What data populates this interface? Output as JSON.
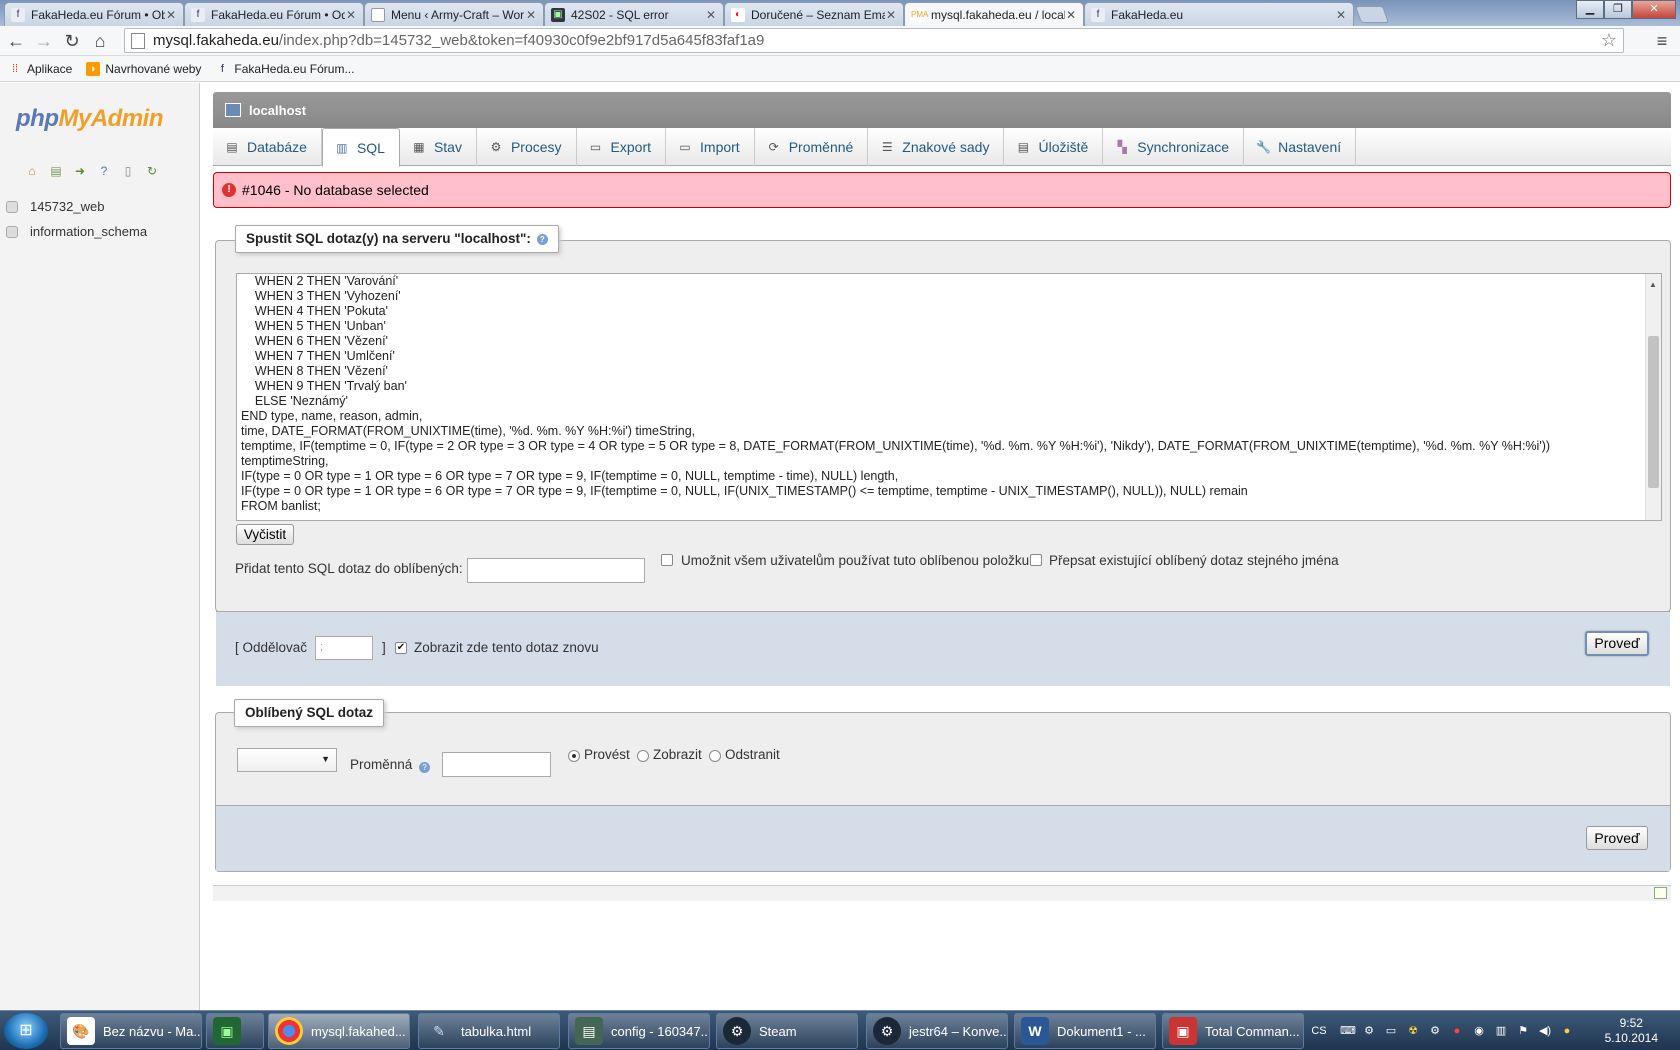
{
  "browser": {
    "tabs": [
      {
        "title": "FakaHeda.eu Fórum • Obs",
        "icon": "page-icon"
      },
      {
        "title": "FakaHeda.eu Fórum • Ode",
        "icon": "page-icon"
      },
      {
        "title": "Menu ‹ Army-Craft – Wor",
        "icon": "page-icon"
      },
      {
        "title": "42S02 - SQL error",
        "icon": "page-icon"
      },
      {
        "title": "Doručené – Seznam Email",
        "icon": "seznam-icon"
      },
      {
        "title": "mysql.fakaheda.eu / locall",
        "icon": "pma-icon"
      },
      {
        "title": "FakaHeda.eu",
        "icon": "page-icon"
      }
    ],
    "url_host": "mysql.fakaheda.eu",
    "url_path": "/index.php?db=145732_web&token=f40930c0f9e2bf917d5a645f83faf1a9",
    "bookmarks": [
      "Aplikace",
      "Navrhované weby",
      "FakaHeda.eu Fórum..."
    ]
  },
  "sidebar": {
    "logo_php": "php",
    "logo_myadmin": "MyAdmin",
    "databases": [
      "145732_web",
      "information_schema"
    ]
  },
  "server": {
    "name": "localhost"
  },
  "nav_tabs": [
    "Databáze",
    "SQL",
    "Stav",
    "Procesy",
    "Export",
    "Import",
    "Proměnné",
    "Znakové sady",
    "Úložiště",
    "Synchronizace",
    "Nastavení"
  ],
  "error": "#1046 - No database selected",
  "sql_section": {
    "legend": "Spustit SQL dotaz(y) na serveru \"localhost\":",
    "query_lines": [
      "    WHEN 2 THEN 'Varování'",
      "    WHEN 3 THEN 'Vyhození'",
      "    WHEN 4 THEN 'Pokuta'",
      "    WHEN 5 THEN 'Unban'",
      "    WHEN 6 THEN 'Vězení'",
      "    WHEN 7 THEN 'Umlčení'",
      "    WHEN 8 THEN 'Vězení'",
      "    WHEN 9 THEN 'Trvalý ban'",
      "    ELSE 'Neznámý'",
      "END type, name, reason, admin,",
      "time, DATE_FORMAT(FROM_UNIXTIME(time), '%d. %m. %Y %H:%i') timeString,",
      "temptime, IF(temptime = 0, IF(type = 2 OR type = 3 OR type = 4 OR type = 5 OR type = 8, DATE_FORMAT(FROM_UNIXTIME(time), '%d. %m. %Y %H:%i'), 'Nikdy'), DATE_FORMAT(FROM_UNIXTIME(temptime), '%d. %m. %Y %H:%i'))",
      "temptimeString,",
      "IF(type = 0 OR type = 1 OR type = 6 OR type = 7 OR type = 9, IF(temptime = 0, NULL, temptime - time), NULL) length,",
      "IF(type = 0 OR type = 1 OR type = 6 OR type = 7 OR type = 9, IF(temptime = 0, NULL, IF(UNIX_TIMESTAMP() <= temptime, temptime - UNIX_TIMESTAMP(), NULL)), NULL) remain",
      "FROM banlist;"
    ],
    "clear_button": "Vyčistit",
    "bookmark_label": "Přidat tento SQL dotaz do oblíbených:",
    "bookmark_value": "",
    "allow_all_label": "Umožnit všem uživatelům používat tuto oblíbenou položku",
    "replace_label": "Přepsat existující oblíbený dotaz stejného jména",
    "delimiter_label_open": "[ Oddělovač",
    "delimiter_value": ";",
    "delimiter_label_close": "]",
    "show_again_label": "Zobrazit zde tento dotaz znovu",
    "show_again_checked": true,
    "go_button": "Proveď"
  },
  "bookmark_section": {
    "legend": "Oblíbený SQL dotaz",
    "variable_label": "Proměnná",
    "variable_value": "",
    "radio_options": [
      "Provést",
      "Zobrazit",
      "Odstranit"
    ],
    "radio_selected": "Provést",
    "go_button": "Proveď"
  },
  "taskbar": {
    "items": [
      {
        "label": "Bez názvu - Ma...",
        "icon": "paint-icon"
      },
      {
        "label": "",
        "icon": "monitor-icon"
      },
      {
        "label": "mysql.fakahed...",
        "icon": "chrome-icon"
      },
      {
        "label": "tabulka.html",
        "icon": "pen-icon"
      },
      {
        "label": "config - 160347...",
        "icon": "folder-icon"
      },
      {
        "label": "Steam",
        "icon": "steam-icon"
      },
      {
        "label": "jestr64 – Konve...",
        "icon": "steam-icon"
      },
      {
        "label": "Dokument1 - ...",
        "icon": "word-icon"
      },
      {
        "label": "Total Comman...",
        "icon": "disk-icon"
      }
    ],
    "lang": "CS",
    "time": "9:52",
    "date": "5.10.2014"
  }
}
